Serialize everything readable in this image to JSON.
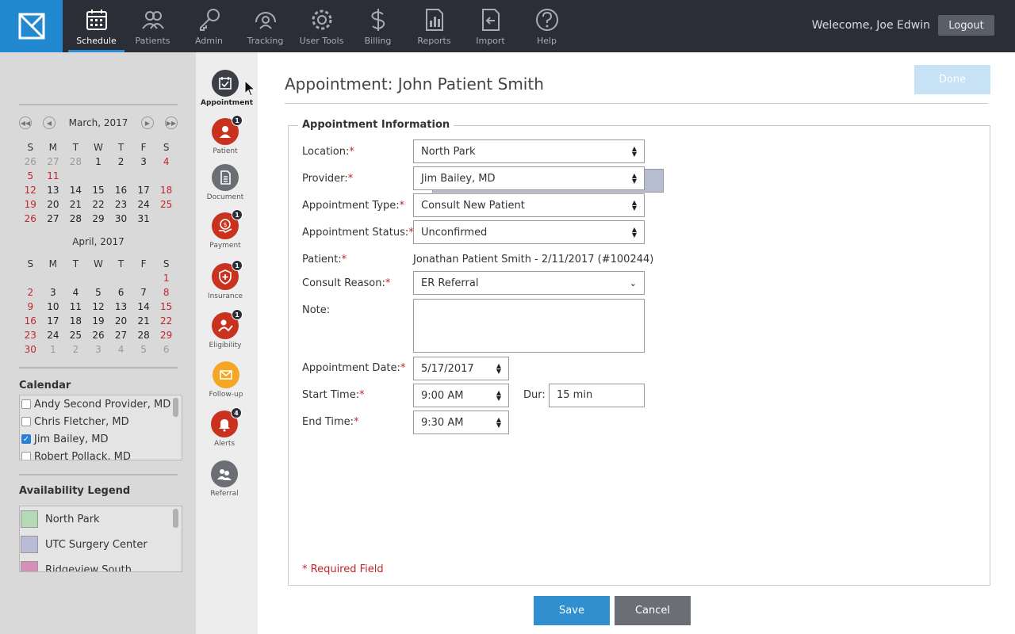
{
  "nav": {
    "items": [
      {
        "label": "Schedule",
        "icon": "calendar-icon",
        "active": true
      },
      {
        "label": "Patients",
        "icon": "patients-icon"
      },
      {
        "label": "Admin",
        "icon": "key-icon"
      },
      {
        "label": "Tracking",
        "icon": "tracking-icon"
      },
      {
        "label": "User Tools",
        "icon": "gear-icon"
      },
      {
        "label": "Billing",
        "icon": "dollar-icon"
      },
      {
        "label": "Reports",
        "icon": "reports-icon"
      },
      {
        "label": "Import",
        "icon": "import-icon"
      },
      {
        "label": "Help",
        "icon": "help-icon"
      }
    ],
    "welcome": "Welecome, Joe Edwin",
    "logout": "Logout"
  },
  "calendar": {
    "march": {
      "title": "March, 2017",
      "days": [
        "S",
        "M",
        "T",
        "W",
        "T",
        "F",
        "S"
      ],
      "weeks": [
        [
          "26",
          "27",
          "28",
          "1",
          "2",
          "3",
          "4"
        ],
        [
          "5",
          "6",
          "7",
          "8",
          "9",
          "10",
          "11"
        ],
        [
          "12",
          "13",
          "14",
          "15",
          "16",
          "17",
          "18"
        ],
        [
          "19",
          "20",
          "21",
          "22",
          "23",
          "24",
          "25"
        ],
        [
          "26",
          "27",
          "28",
          "29",
          "30",
          "31",
          ""
        ]
      ]
    },
    "april": {
      "title": "April, 2017",
      "days": [
        "S",
        "M",
        "T",
        "W",
        "T",
        "F",
        "S"
      ],
      "weeks": [
        [
          "",
          "",
          "",
          "",
          "",
          "",
          "1"
        ],
        [
          "2",
          "3",
          "4",
          "5",
          "6",
          "7",
          "8"
        ],
        [
          "9",
          "10",
          "11",
          "12",
          "13",
          "14",
          "15"
        ],
        [
          "16",
          "17",
          "18",
          "19",
          "20",
          "21",
          "22"
        ],
        [
          "23",
          "24",
          "25",
          "26",
          "27",
          "28",
          "29"
        ],
        [
          "30",
          "1",
          "2",
          "3",
          "4",
          "5",
          "6"
        ]
      ]
    }
  },
  "calendar_list": {
    "label": "Calendar",
    "items": [
      {
        "name": "Andy Second Provider, MD",
        "checked": false
      },
      {
        "name": "Chris Fletcher, MD",
        "checked": false
      },
      {
        "name": "Jim Bailey, MD",
        "checked": true
      },
      {
        "name": "Robert Pollack, MD",
        "checked": false
      }
    ]
  },
  "legend": {
    "label": "Availability Legend",
    "items": [
      {
        "name": "North Park",
        "color": "#b5d9b5"
      },
      {
        "name": "UTC Surgery Center",
        "color": "#b9bcd6"
      },
      {
        "name": "Ridgeview South",
        "color": "#d58fb9"
      }
    ]
  },
  "sidebar": {
    "items": [
      {
        "label": "Appointment",
        "badge": ""
      },
      {
        "label": "Patient",
        "badge": "1"
      },
      {
        "label": "Document",
        "badge": ""
      },
      {
        "label": "Payment",
        "badge": "1"
      },
      {
        "label": "Insurance",
        "badge": "1"
      },
      {
        "label": "Eligibility",
        "badge": "1"
      },
      {
        "label": "Follow-up",
        "badge": ""
      },
      {
        "label": "Alerts",
        "badge": "4"
      },
      {
        "label": "Referral",
        "badge": ""
      }
    ]
  },
  "main": {
    "title": "Appointment: John Patient Smith",
    "done": "Done",
    "section": "Appointment Information",
    "fields": {
      "location": {
        "label": "Location:",
        "value": "North Park"
      },
      "provider": {
        "label": "Provider:",
        "value": "Jim Bailey, MD"
      },
      "type": {
        "label": "Appointment Type:",
        "value": "Consult New Patient"
      },
      "status": {
        "label": "Appointment Status:",
        "value": "Unconfirmed"
      },
      "patient": {
        "label": "Patient:",
        "value": "Jonathan Patient Smith - 2/11/2017 (#100244)"
      },
      "reason": {
        "label": "Consult Reason:",
        "value": "ER Referral"
      },
      "note": {
        "label": "Note:",
        "value": ""
      },
      "date": {
        "label": "Appointment Date:",
        "value": "5/17/2017"
      },
      "start": {
        "label": "Start Time:",
        "value": "9:00 AM"
      },
      "dur": {
        "label": "Dur:",
        "value": "15 min"
      },
      "end": {
        "label": "End Time:",
        "value": "9:30 AM"
      }
    },
    "required_note": "* Required Field",
    "save": "Save",
    "cancel": "Cancel"
  }
}
